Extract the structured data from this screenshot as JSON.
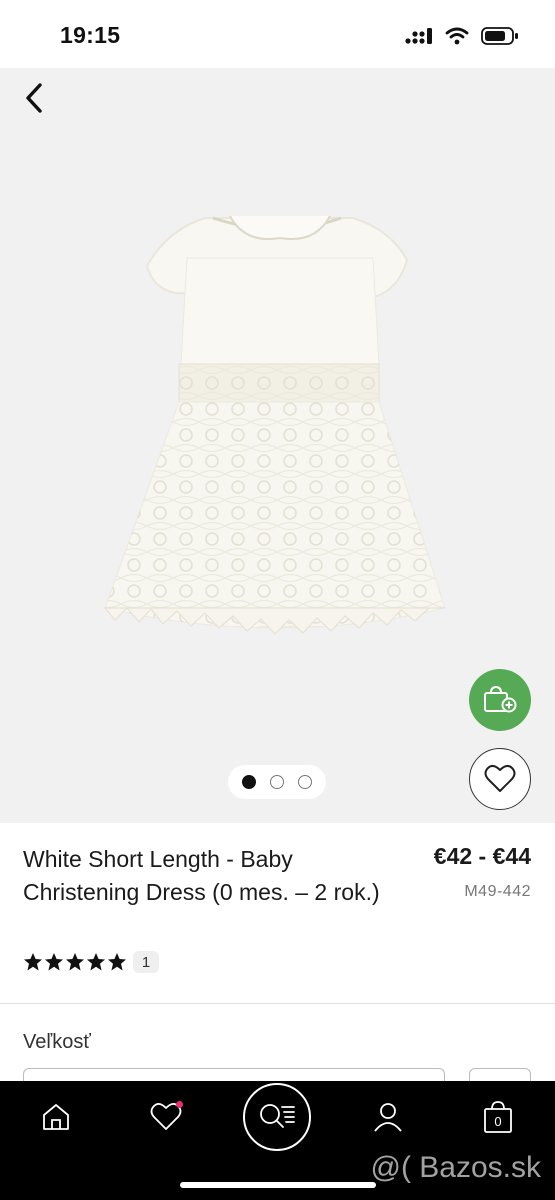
{
  "status_bar": {
    "time": "19:15"
  },
  "product": {
    "title": "White Short Length - Baby Christening Dress (0 mes. – 2 rok.)",
    "price": "€42 - €44",
    "sku": "M49-442",
    "rating": 5,
    "review_count": "1"
  },
  "gallery": {
    "image_count": 3,
    "active_index": 0
  },
  "size": {
    "label": "Veľkosť"
  },
  "bottom_nav": {
    "bag_count": "0"
  },
  "watermark": "@( Bazos.sk",
  "colors": {
    "accent_green": "#56aa55",
    "notification_pink": "#e8316b",
    "nav_bg": "#000000"
  },
  "icons": [
    "back-arrow-icon",
    "add-to-bag-icon",
    "heart-icon",
    "home-icon",
    "wishlist-icon",
    "search-menu-icon",
    "account-icon",
    "bag-icon"
  ]
}
